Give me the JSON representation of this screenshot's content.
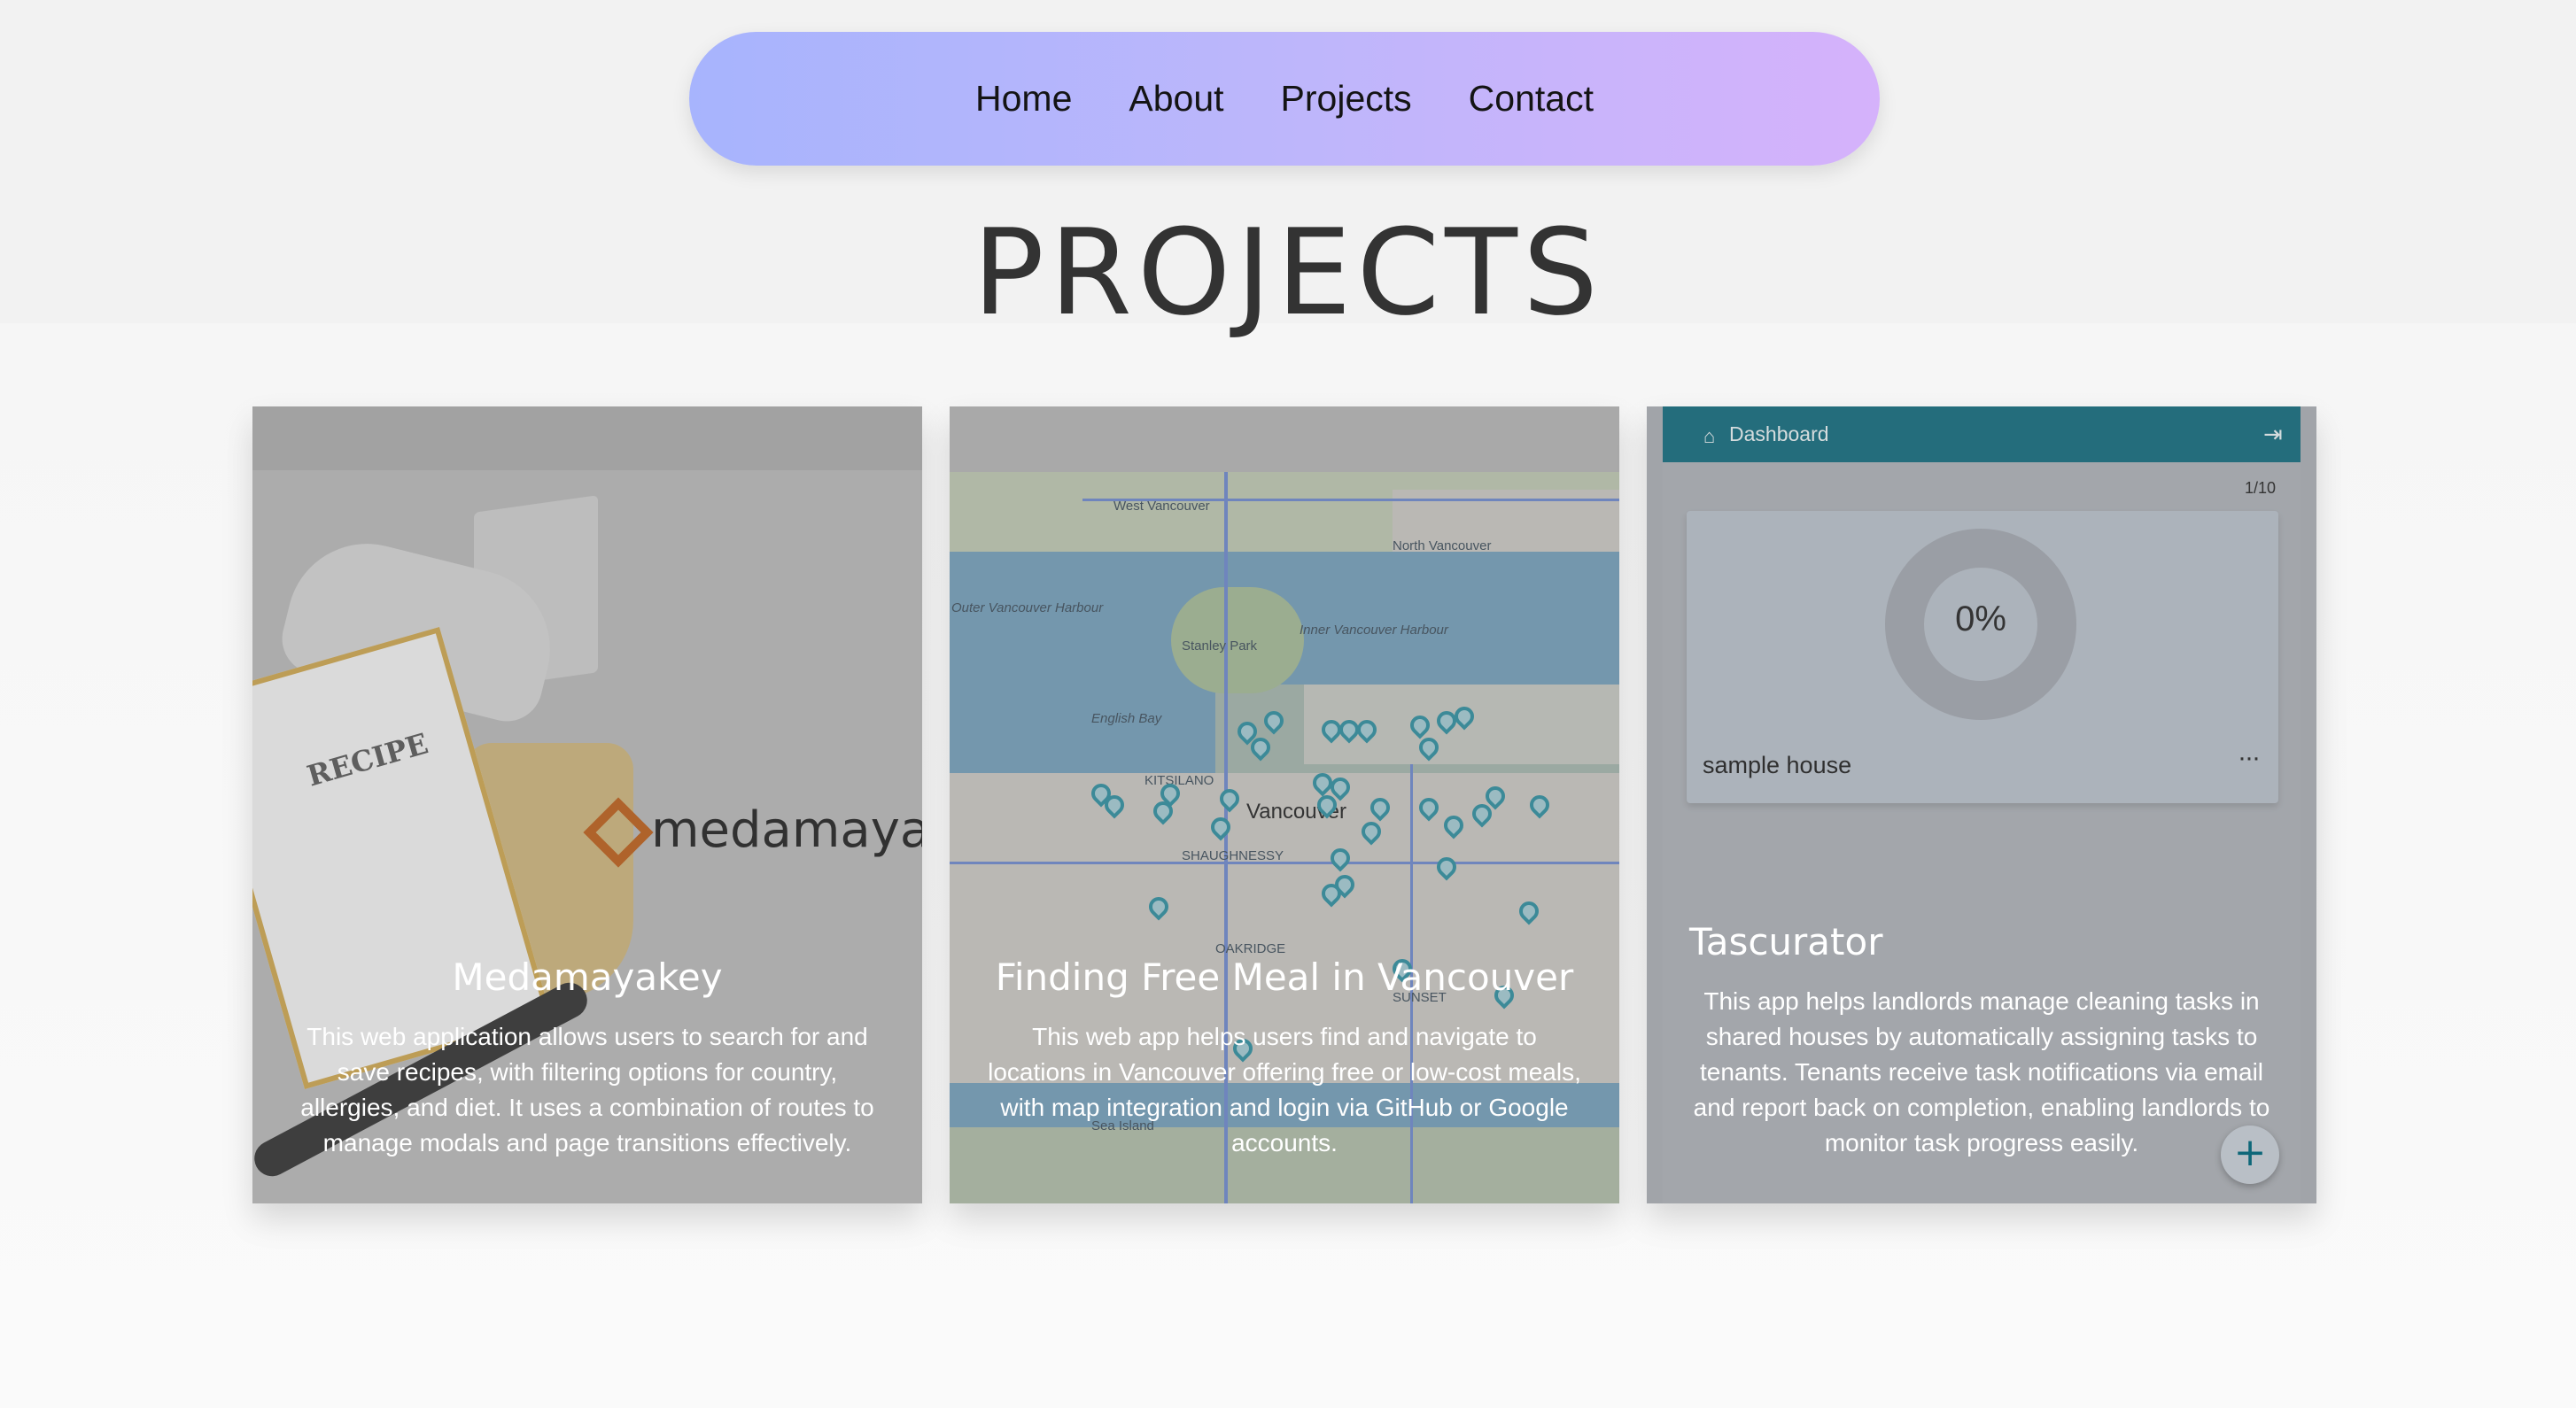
{
  "nav": {
    "links": [
      "Home",
      "About",
      "Projects",
      "Contact"
    ]
  },
  "page_title": "PROJECTS",
  "projects": [
    {
      "title": "Medamayakey",
      "description": "This web application allows users to search for and save recipes, with filtering options for country, allergies, and diet. It uses a combination of routes to manage modals and page transitions effectively.",
      "image": {
        "logo_text": "medamayak",
        "book_text": "RECIPE"
      }
    },
    {
      "title": "Finding Free Meal in Vancouver",
      "description": "This web app helps users find and navigate to locations in Vancouver offering free or low-cost meals, with map integration and login via GitHub or Google accounts.",
      "image": {
        "labels": [
          "West Vancouver",
          "North Vancouver",
          "Outer Vancouver Harbour",
          "Inner Vancouver Harbour",
          "Stanley Park",
          "English Bay",
          "Vancouver",
          "KITSILANO",
          "SHAUGHNESSY",
          "OAKRIDGE",
          "SUNSET",
          "Sea Island"
        ]
      }
    },
    {
      "title": "Tascurator",
      "description": "This app helps landlords manage cleaning tasks in shared houses by automatically assigning tasks to tenants. Tenants receive task notifications via email and report back on completion, enabling landlords to monitor task progress easily.",
      "image": {
        "header": "Dashboard",
        "pagination": "1/10",
        "progress_label": "0%",
        "progress_value": 0,
        "house_name": "sample house",
        "menu_label": "···",
        "add_label": "+"
      }
    }
  ],
  "colors": {
    "nav_gradient_start": "#a7b4fd",
    "nav_gradient_end": "#d5b2fb",
    "dashboard_header": "#0e6779",
    "logo_accent": "#b85b17"
  }
}
